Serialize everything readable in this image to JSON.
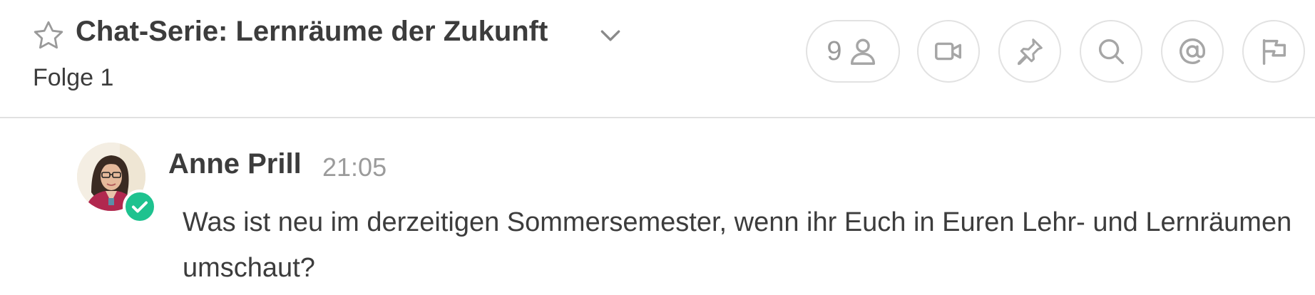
{
  "channel": {
    "title": "Chat-Serie: Lernräume der Zukunft",
    "subtitle": "Folge 1"
  },
  "toolbar": {
    "members_count": "9",
    "icons": [
      "star-icon",
      "chevron-down-icon",
      "user-icon",
      "video-icon",
      "pin-icon",
      "search-icon",
      "at-icon",
      "flag-icon"
    ]
  },
  "message": {
    "author": "Anne Prill",
    "time": "21:05",
    "text": "Was ist neu im derzeitigen Sommersemester, wenn ihr Euch in Euren Lehr- und Lernräumen umschaut?"
  },
  "colors": {
    "status_online": "#1ec28f",
    "icon_gray": "#a6a6a6",
    "divider": "#e1e1e1"
  }
}
